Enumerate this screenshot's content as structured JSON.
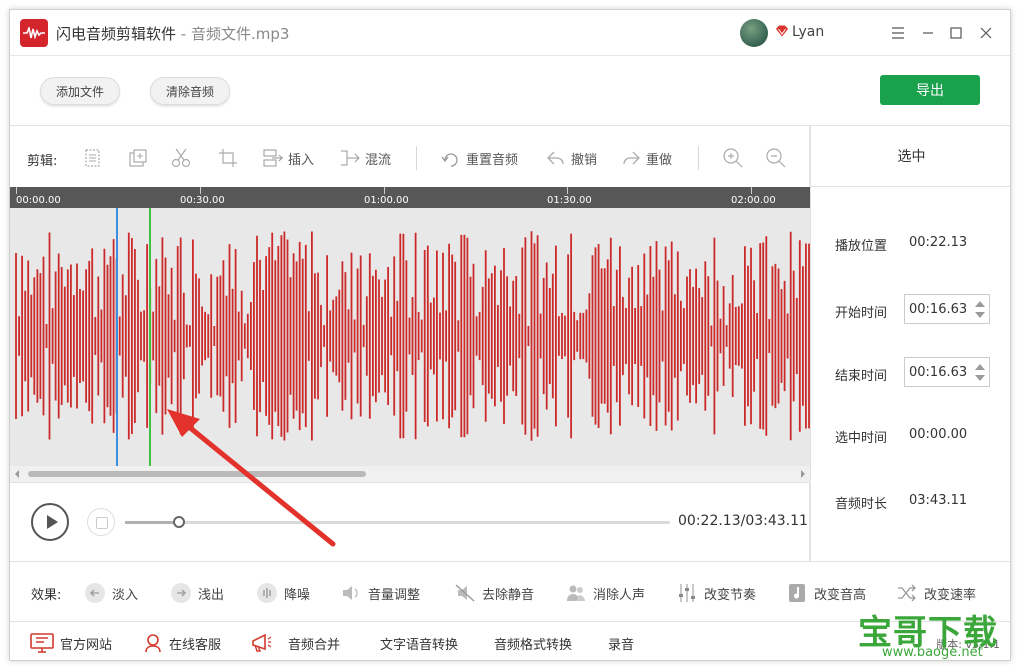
{
  "app": {
    "title": "闪电音频剪辑软件",
    "separator": " - ",
    "file": "音频文件.mp3"
  },
  "user": {
    "name": "Lyan"
  },
  "colors": {
    "accent_green": "#19a14b",
    "wave_red": "#cc2a2a",
    "cursor_blue": "#3b8fe0",
    "selection_green": "#3fc23f",
    "arrow_red": "#e3322b"
  },
  "toolbar": {
    "add_file": "添加文件",
    "clear_audio": "清除音频",
    "export": "导出"
  },
  "edit": {
    "label": "剪辑:",
    "insert": "插入",
    "mix": "混流",
    "reset": "重置音频",
    "undo": "撤销",
    "redo": "重做"
  },
  "timeline": {
    "ticks": [
      "00:00.00",
      "00:30.00",
      "01:00.00",
      "01:30.00",
      "02:00.00"
    ]
  },
  "player": {
    "time": "00:22.13/03:43.11",
    "progress": 0.099
  },
  "panel": {
    "header": "选中",
    "play_pos_label": "播放位置",
    "play_pos": "00:22.13",
    "start_label": "开始时间",
    "start": "00:16.63",
    "end_label": "结束时间",
    "end": "00:16.63",
    "selected_label": "选中时间",
    "selected": "00:00.00",
    "duration_label": "音频时长",
    "duration": "03:43.11"
  },
  "effects": {
    "label": "效果:",
    "fade_in": "淡入",
    "fade_out": "浅出",
    "denoise": "降噪",
    "volume": "音量调整",
    "remove_silence": "去除静音",
    "remove_vocal": "消除人声",
    "tempo": "改变节奏",
    "pitch": "改变音高",
    "speed": "改变速率"
  },
  "bottom": {
    "website": "官方网站",
    "support": "在线客服",
    "merge": "音频合并",
    "tts": "文字语音转换",
    "convert": "音频格式转换",
    "record": "录音",
    "version": "版本: v3.1.1"
  },
  "watermark": {
    "big": "宝哥下载",
    "url": "www.baoge.net"
  }
}
